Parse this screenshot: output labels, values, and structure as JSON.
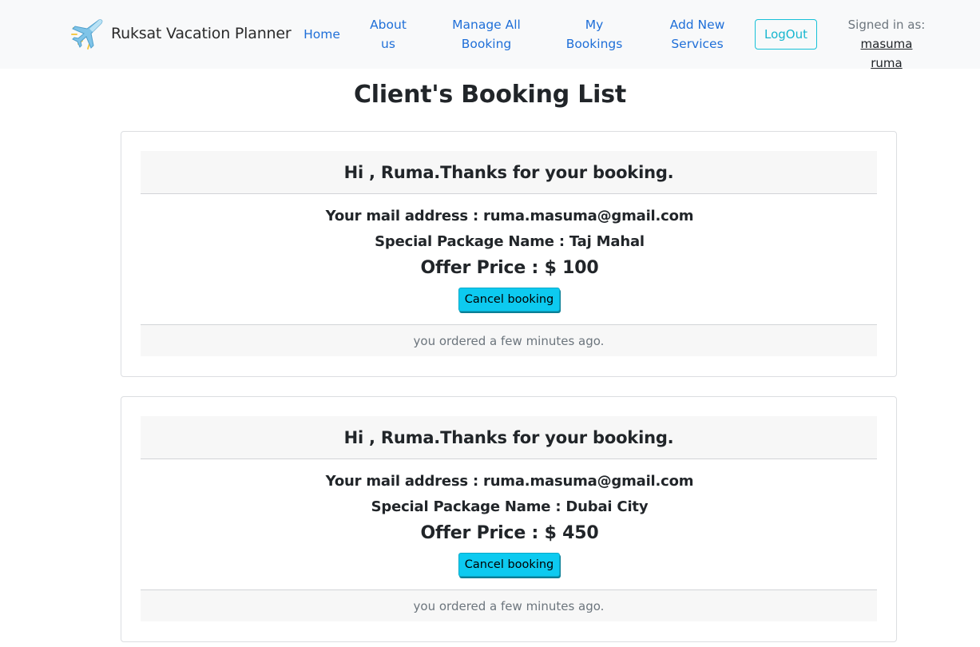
{
  "navbar": {
    "brand_title": "Ruksat Vacation Planner",
    "brand_icon": "airplane-icon",
    "links": [
      {
        "line1": "Home",
        "line2": ""
      },
      {
        "line1": "About",
        "line2": "us"
      },
      {
        "line1": "Manage All",
        "line2": "Booking"
      },
      {
        "line1": "My",
        "line2": "Bookings"
      },
      {
        "line1": "Add New",
        "line2": "Services"
      }
    ],
    "logout_label": "LogOut",
    "signed_in_label": "Signed in as:",
    "user_first": "masuma",
    "user_last": "ruma"
  },
  "page": {
    "title": "Client's Booking List"
  },
  "bookings": [
    {
      "greeting": "Hi , Ruma.Thanks for your booking.",
      "mail": "Your mail address : ruma.masuma@gmail.com",
      "package": "Special Package Name : Taj Mahal",
      "price": "Offer Price : $ 100",
      "cancel_label": "Cancel booking",
      "footer": "you ordered a few minutes ago."
    },
    {
      "greeting": "Hi , Ruma.Thanks for your booking.",
      "mail": "Your mail address : ruma.masuma@gmail.com",
      "package": "Special Package Name : Dubai City",
      "price": "Offer Price : $ 450",
      "cancel_label": "Cancel booking",
      "footer": "you ordered a few minutes ago."
    }
  ],
  "colors": {
    "nav_link": "#1f6fd8",
    "logout": "#17c1d8",
    "cancel_button": "#0dcaf0",
    "navbar_bg": "#f8f9fa",
    "card_header_bg": "#f7f7f7"
  }
}
